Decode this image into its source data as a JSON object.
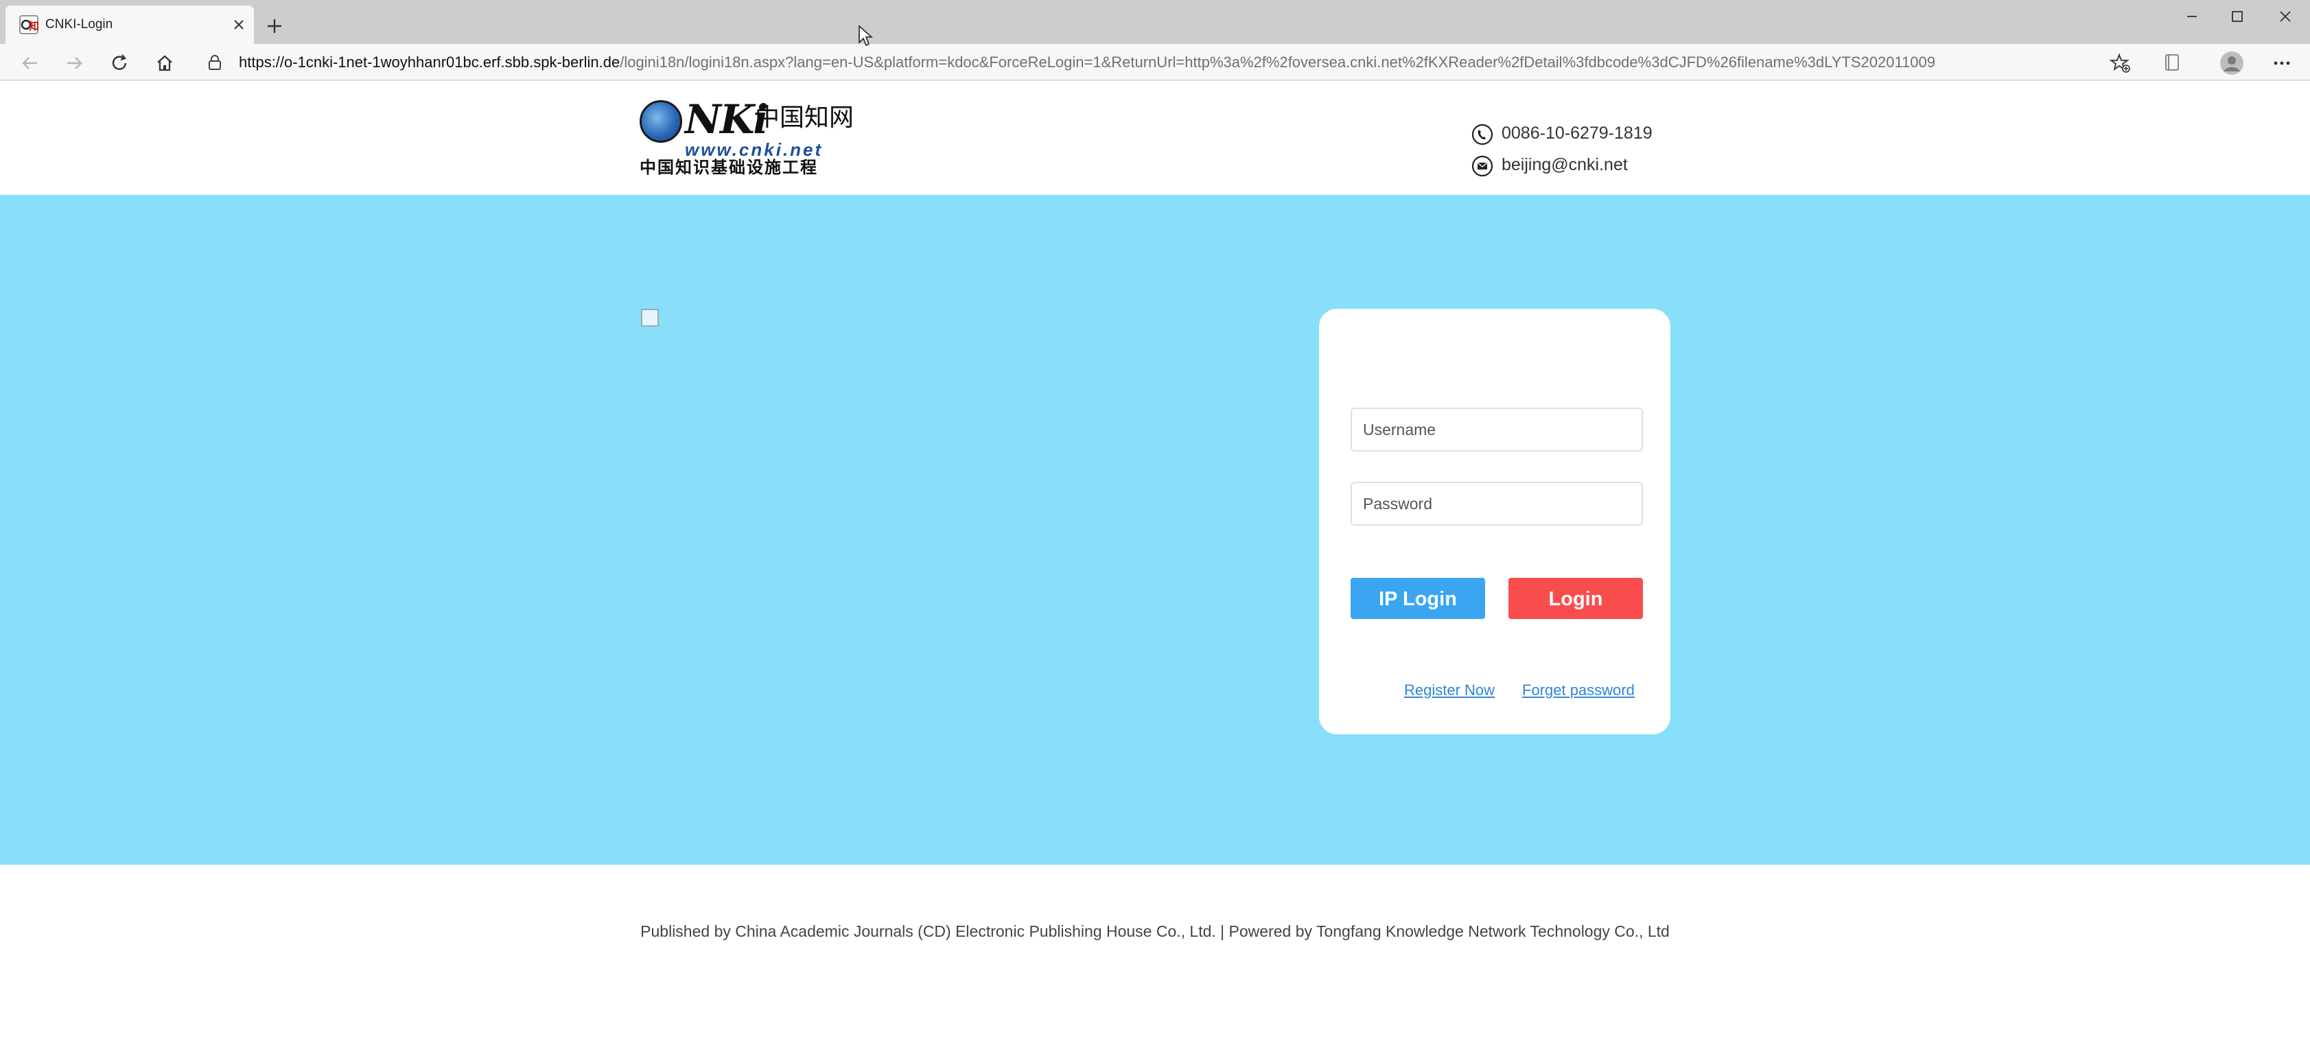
{
  "browser": {
    "tab": {
      "title": "CNKI-Login",
      "favicon": "cnki-favicon"
    },
    "address": {
      "host": "https://o-1cnki-1net-1woyhhanr01bc.erf.sbb.spk-berlin.de",
      "path": "/logini18n/logini18n.aspx?lang=en-US&platform=kdoc&ForceReLogin=1&ReturnUrl=http%3a%2f%2foversea.cnki.net%2fKXReader%2fDetail%3fdbcode%3dCJFD%26filename%3dLYTS202011009"
    },
    "icons": [
      "back-icon",
      "forward-icon",
      "reload-icon",
      "home-icon",
      "lock-icon",
      "add-favorite-icon",
      "collections-icon",
      "profile-icon",
      "more-icon",
      "minimize-icon",
      "maximize-icon",
      "close-icon",
      "new-tab-icon"
    ]
  },
  "header": {
    "logo": {
      "mark": "C",
      "brand": "NKi",
      "cn_title": "中国知网",
      "url": "www.cnki.net",
      "cn_subtitle": "中国知识基础设施工程"
    },
    "contact": {
      "phone": "0086-10-6279-1819",
      "email": "beijing@cnki.net"
    }
  },
  "login": {
    "username_placeholder": "Username",
    "password_placeholder": "Password",
    "ip_login_label": "IP Login",
    "login_label": "Login",
    "register_label": "Register Now",
    "forget_label": "Forget password"
  },
  "footer": {
    "text": "Published by China Academic Journals (CD) Electronic Publishing House Co., Ltd. | Powered by Tongfang Knowledge Network Technology Co., Ltd"
  },
  "colors": {
    "chrome_bg": "#cdcdcd",
    "hero_bg": "#87dff9",
    "ip_login_bg": "#3aa6f2",
    "login_bg": "#f94d4d",
    "link": "#2f86d8"
  }
}
